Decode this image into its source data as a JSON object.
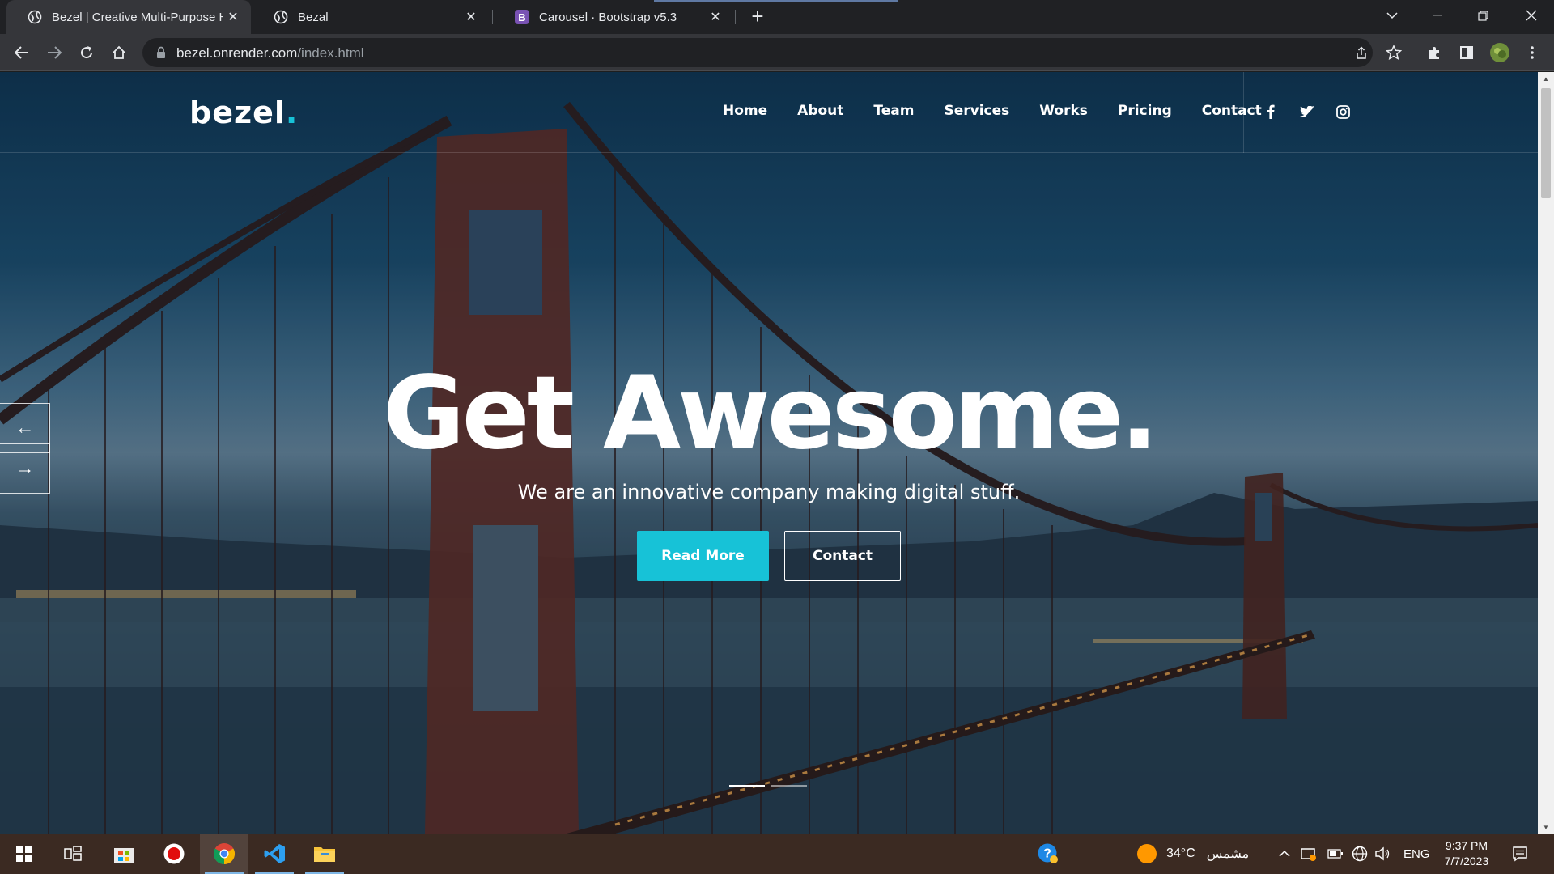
{
  "browser": {
    "tabs": [
      {
        "title": "Bezel | Creative Multi-Purpose H",
        "active": true
      },
      {
        "title": "Bezal",
        "active": false
      },
      {
        "title": "Carousel · Bootstrap v5.3",
        "active": false
      }
    ],
    "bootstrap_favicon_letter": "B",
    "new_tab_label": "+",
    "url_host": "bezel.onrender.com",
    "url_path": "/index.html"
  },
  "site": {
    "logo": "bezel",
    "logo_dot": ".",
    "nav": [
      "Home",
      "About",
      "Team",
      "Services",
      "Works",
      "Pricing",
      "Contact"
    ],
    "social_icons": [
      "facebook-icon",
      "twitter-icon",
      "instagram-icon"
    ],
    "accent_color": "#17c2d7"
  },
  "hero": {
    "headline": "Get Awesome.",
    "subtitle": "We are an innovative company making digital stuff.",
    "primary_button": "Read More",
    "secondary_button": "Contact",
    "prev_arrow": "←",
    "next_arrow": "→",
    "slide_count": 2,
    "active_slide": 1
  },
  "taskbar": {
    "weather_temp": "34°C",
    "weather_text": "مشمس",
    "language": "ENG",
    "time": "9:37 PM",
    "date": "7/7/2023"
  }
}
